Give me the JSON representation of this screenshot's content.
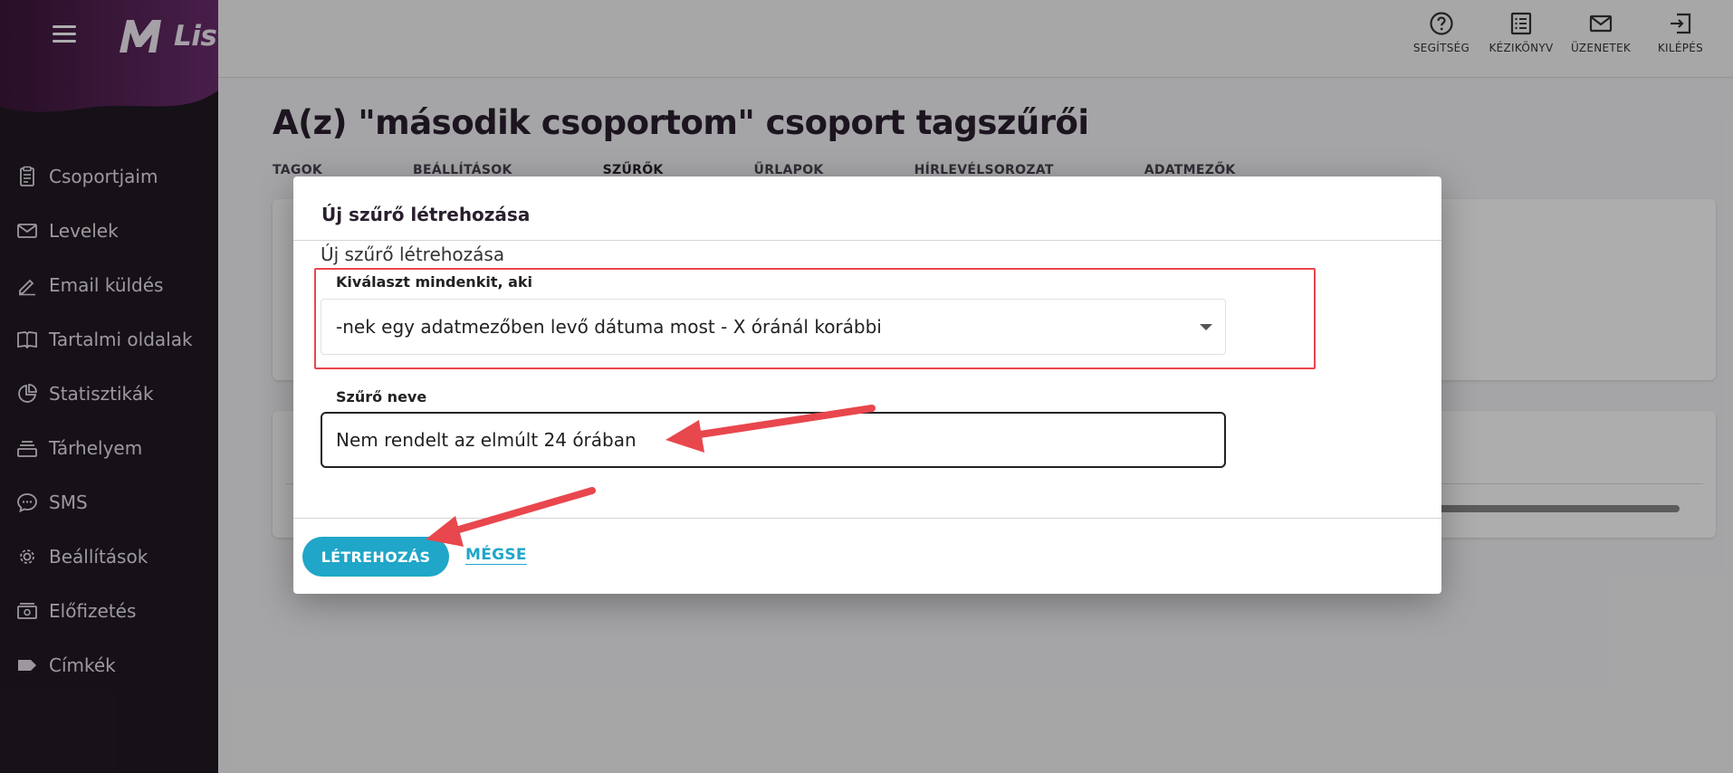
{
  "app": {
    "name": "ListaMester"
  },
  "sidebar": {
    "items": [
      {
        "label": "Csoportjaim",
        "icon": "clipboard-icon"
      },
      {
        "label": "Levelek",
        "icon": "mail-icon"
      },
      {
        "label": "Email küldés",
        "icon": "pencil-icon"
      },
      {
        "label": "Tartalmi oldalak",
        "icon": "book-icon"
      },
      {
        "label": "Statisztikák",
        "icon": "pie-chart-icon"
      },
      {
        "label": "Tárhelyem",
        "icon": "storage-icon"
      },
      {
        "label": "SMS",
        "icon": "chat-icon"
      },
      {
        "label": "Beállítások",
        "icon": "gear-icon"
      },
      {
        "label": "Előfizetés",
        "icon": "money-icon"
      },
      {
        "label": "Címkék",
        "icon": "tag-icon"
      }
    ]
  },
  "topbar": {
    "actions": [
      {
        "label": "SEGÍTSÉG",
        "icon": "help-icon"
      },
      {
        "label": "KÉZIKÖNYV",
        "icon": "manual-icon"
      },
      {
        "label": "ÜZENETEK",
        "icon": "mail-icon"
      },
      {
        "label": "KILÉPÉS",
        "icon": "logout-icon"
      }
    ]
  },
  "page": {
    "title": "A(z) \"második csoportom\" csoport tagszűrői",
    "tabs": [
      "TAGOK",
      "BEÁLLÍTÁSOK",
      "SZŰRŐK",
      "ŰRLAPOK",
      "HÍRLEVÉLSOROZAT",
      "ADATMEZŐK"
    ],
    "active_tab": "SZŰRŐK"
  },
  "modal": {
    "title": "Új szűrő létrehozása",
    "subtitle": "Új szűrő létrehozása",
    "select_label": "Kiválaszt mindenkit, aki",
    "select_value": "-nek egy adatmezőben levő dátuma most - X óránál korábbi",
    "name_label": "Szűrő neve",
    "name_value": "Nem rendelt az elmúlt 24 órában",
    "create_button": "LÉTREHOZÁS",
    "cancel_button": "MÉGSE"
  },
  "colors": {
    "sidebar_bg": "#201a22",
    "brand_purple": "#6b2d6e",
    "accent_cyan": "#1fa6c8",
    "annotation_red": "#e8474d"
  }
}
